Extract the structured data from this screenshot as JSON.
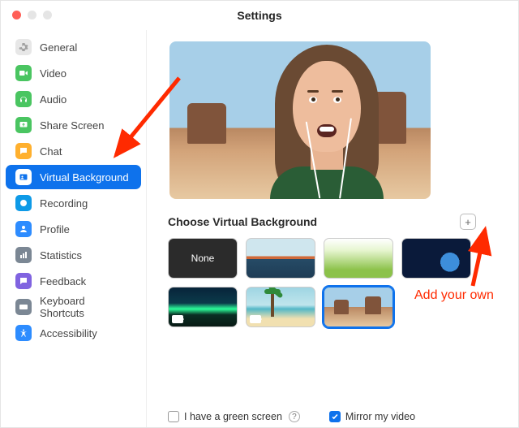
{
  "window": {
    "title": "Settings"
  },
  "sidebar": {
    "items": [
      {
        "name": "general",
        "label": "General",
        "icon": "gear-icon",
        "iconBg": "#e7e7e7",
        "iconFg": "#9a9a9a"
      },
      {
        "name": "video",
        "label": "Video",
        "icon": "video-icon",
        "iconBg": "#4ac561",
        "iconFg": "#ffffff"
      },
      {
        "name": "audio",
        "label": "Audio",
        "icon": "headphones-icon",
        "iconBg": "#4ac561",
        "iconFg": "#ffffff"
      },
      {
        "name": "share-screen",
        "label": "Share Screen",
        "icon": "share-icon",
        "iconBg": "#4ac561",
        "iconFg": "#ffffff"
      },
      {
        "name": "chat",
        "label": "Chat",
        "icon": "chat-icon",
        "iconBg": "#ffb02e",
        "iconFg": "#ffffff"
      },
      {
        "name": "virtual-background",
        "label": "Virtual Background",
        "icon": "person-card-icon",
        "iconBg": "#ffffff",
        "iconFg": "#0e72ec",
        "selected": true
      },
      {
        "name": "recording",
        "label": "Recording",
        "icon": "record-icon",
        "iconBg": "#0e9ae7",
        "iconFg": "#ffffff"
      },
      {
        "name": "profile",
        "label": "Profile",
        "icon": "user-icon",
        "iconBg": "#2d8cff",
        "iconFg": "#ffffff"
      },
      {
        "name": "statistics",
        "label": "Statistics",
        "icon": "stats-icon",
        "iconBg": "#7b8794",
        "iconFg": "#ffffff"
      },
      {
        "name": "feedback",
        "label": "Feedback",
        "icon": "feedback-icon",
        "iconBg": "#8063e0",
        "iconFg": "#ffffff"
      },
      {
        "name": "keyboard-shortcuts",
        "label": "Keyboard Shortcuts",
        "icon": "keyboard-icon",
        "iconBg": "#7b8794",
        "iconFg": "#ffffff"
      },
      {
        "name": "accessibility",
        "label": "Accessibility",
        "icon": "accessibility-icon",
        "iconBg": "#2d8cff",
        "iconFg": "#ffffff"
      }
    ]
  },
  "content": {
    "section_title": "Choose Virtual Background",
    "add_button_symbol": "+",
    "thumbnails": [
      {
        "name": "none",
        "label": "None",
        "type": "none"
      },
      {
        "name": "golden-gate",
        "type": "image"
      },
      {
        "name": "grass",
        "type": "image"
      },
      {
        "name": "earth-space",
        "type": "image"
      },
      {
        "name": "aurora",
        "type": "video"
      },
      {
        "name": "beach",
        "type": "video"
      },
      {
        "name": "desert",
        "type": "image",
        "selected": true
      }
    ],
    "options": {
      "green_screen": {
        "label": "I have a green screen",
        "checked": false
      },
      "mirror": {
        "label": "Mirror my video",
        "checked": true
      }
    }
  },
  "annotations": {
    "arrow_to_sidebar": true,
    "arrow_to_add": true,
    "add_label": "Add your own"
  }
}
